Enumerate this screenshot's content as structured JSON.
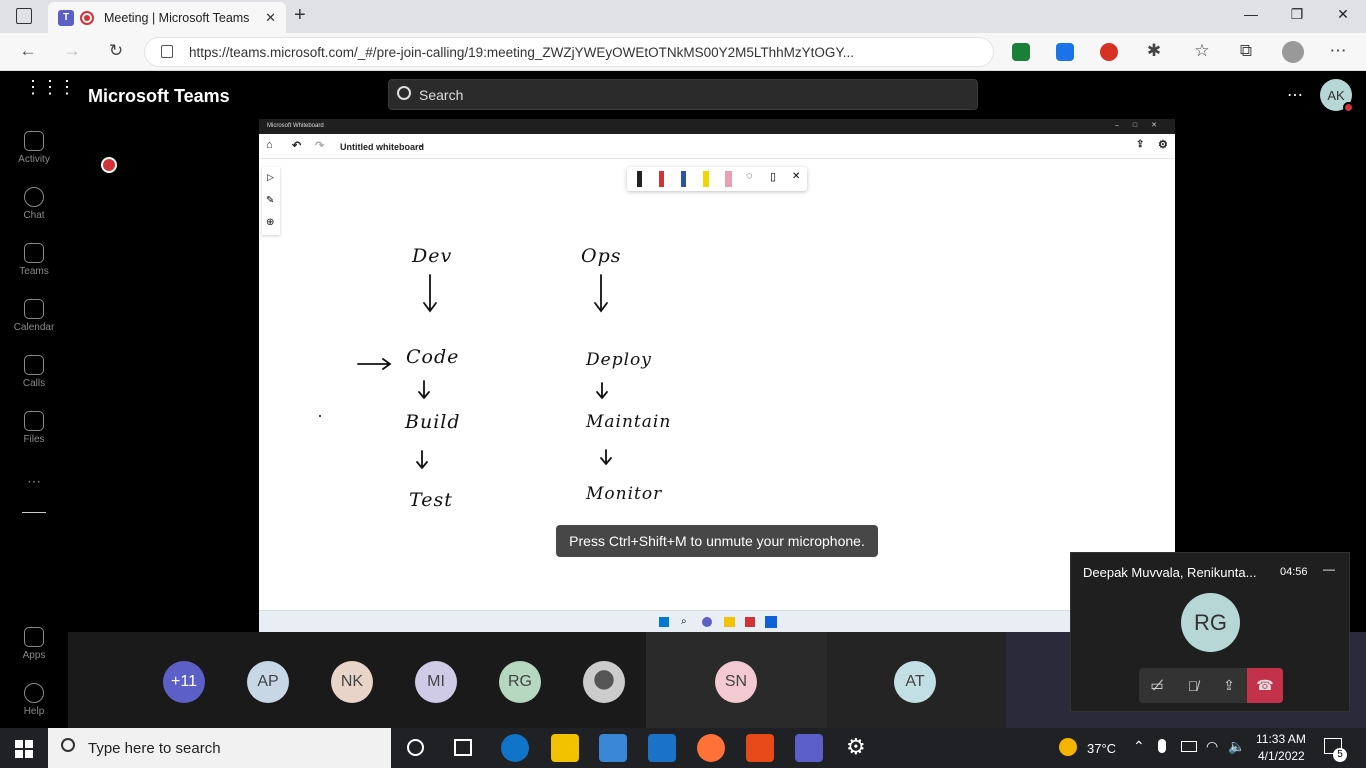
{
  "browser": {
    "tab_title": "Meeting | Microsoft Teams",
    "url": "https://teams.microsoft.com/_#/pre-join-calling/19:meeting_ZWZjYWEyOWEtOTNkMS00Y2M5LThhMzYtOGY..."
  },
  "teams": {
    "app_title": "Microsoft Teams",
    "search_placeholder": "Search",
    "user_initials": "AK",
    "rail": [
      "Activity",
      "Chat",
      "Teams",
      "Calendar",
      "Calls",
      "Files",
      "Apps",
      "Help"
    ]
  },
  "whiteboard": {
    "window_title": "Microsoft Whiteboard",
    "doc_title": "Untitled whiteboard",
    "dev_column": [
      "Dev",
      "Code",
      "Build",
      "Test"
    ],
    "ops_column": [
      "Ops",
      "Deploy",
      "Maintain",
      "Monitor"
    ]
  },
  "toast": "Press Ctrl+Shift+M to unmute your microphone.",
  "participants": [
    {
      "initials": "+11",
      "color": "#5b5fc7",
      "text_color": "#ffffff"
    },
    {
      "initials": "AP",
      "color": "#c7d7e6",
      "text_color": "#444444"
    },
    {
      "initials": "NK",
      "color": "#e8d4c8",
      "text_color": "#444444"
    },
    {
      "initials": "MI",
      "color": "#cfcbe6",
      "text_color": "#444444"
    },
    {
      "initials": "RG",
      "color": "#b6d7c0",
      "text_color": "#444444"
    },
    {
      "initials": "",
      "color": "#888888",
      "text_color": "#444444"
    },
    {
      "initials": "SN",
      "color": "#f3c9d2",
      "text_color": "#444444"
    },
    {
      "initials": "AT",
      "color": "#c2e0e3",
      "text_color": "#444444"
    }
  ],
  "call": {
    "participants_label": "Deepak Muvvala, Renikunta...",
    "duration": "04:56",
    "avatar": "RG"
  },
  "taskbar": {
    "search_placeholder": "Type here to search",
    "temperature": "37°C",
    "time": "11:33 AM",
    "date": "4/1/2022",
    "notifications": "5"
  }
}
